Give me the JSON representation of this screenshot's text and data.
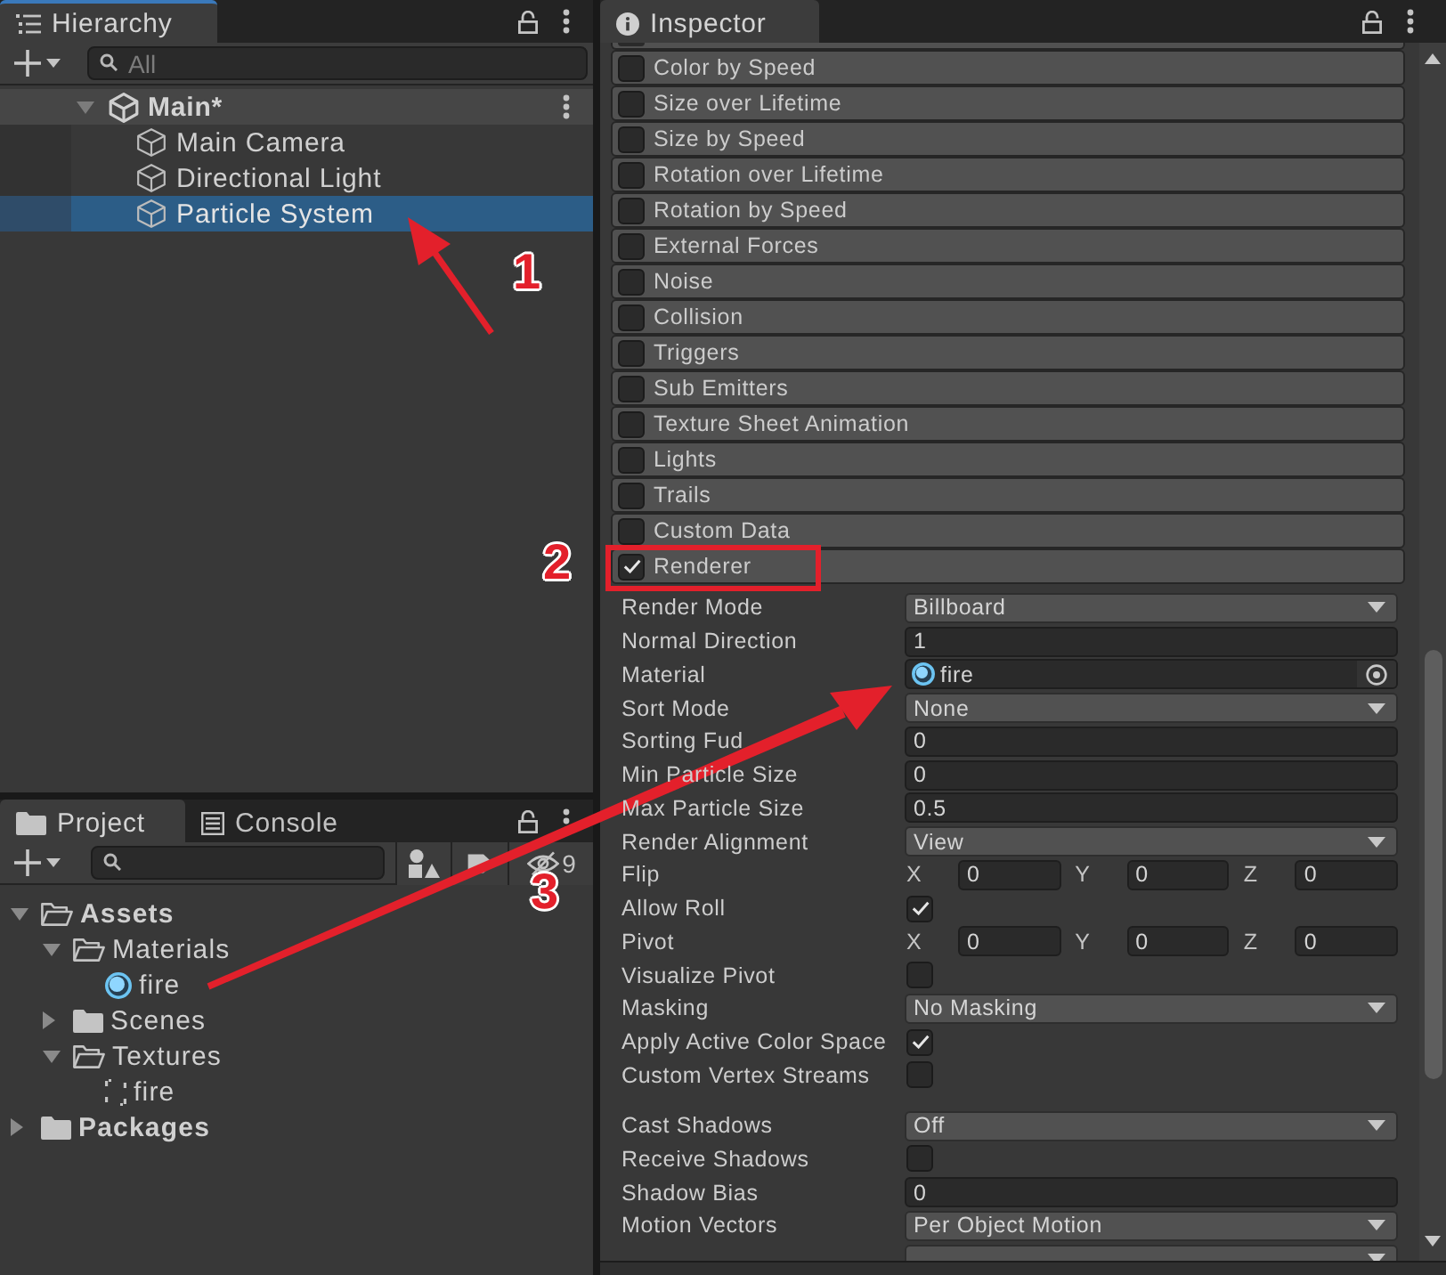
{
  "hierarchy": {
    "tab": {
      "label": "Hierarchy",
      "focused": true
    },
    "search": {
      "placeholder": "All"
    },
    "scene": {
      "name": "Main*",
      "expanded": true
    },
    "items": [
      {
        "name": "Main Camera",
        "selected": false
      },
      {
        "name": "Directional Light",
        "selected": false
      },
      {
        "name": "Particle System",
        "selected": true
      }
    ]
  },
  "project": {
    "tabs": [
      {
        "label": "Project",
        "kind": "project",
        "selected": true,
        "focused": false
      },
      {
        "label": "Console",
        "kind": "console",
        "selected": false,
        "focused": false
      }
    ],
    "hidden_count": "9",
    "tree": [
      {
        "name": "Assets",
        "kind": "folder",
        "expanded": true,
        "children": [
          {
            "name": "Materials",
            "kind": "folder",
            "expanded": true,
            "children": [
              {
                "name": "fire",
                "kind": "material"
              }
            ]
          },
          {
            "name": "Scenes",
            "kind": "folder",
            "expanded": false
          },
          {
            "name": "Textures",
            "kind": "folder",
            "expanded": true,
            "children": [
              {
                "name": "fire",
                "kind": "texture"
              }
            ]
          }
        ]
      },
      {
        "name": "Packages",
        "kind": "folder",
        "expanded": false
      }
    ]
  },
  "inspector": {
    "tab": {
      "label": "Inspector",
      "focused": false
    },
    "modules": [
      {
        "name": "Color by Speed",
        "enabled": false,
        "highlighted": false
      },
      {
        "name": "Size over Lifetime",
        "enabled": false,
        "highlighted": false
      },
      {
        "name": "Size by Speed",
        "enabled": false,
        "highlighted": false
      },
      {
        "name": "Rotation over Lifetime",
        "enabled": false,
        "highlighted": false
      },
      {
        "name": "Rotation by Speed",
        "enabled": false,
        "highlighted": false
      },
      {
        "name": "External Forces",
        "enabled": false,
        "highlighted": false
      },
      {
        "name": "Noise",
        "enabled": false,
        "highlighted": false
      },
      {
        "name": "Collision",
        "enabled": false,
        "highlighted": false
      },
      {
        "name": "Triggers",
        "enabled": false,
        "highlighted": false
      },
      {
        "name": "Sub Emitters",
        "enabled": false,
        "highlighted": false
      },
      {
        "name": "Texture Sheet Animation",
        "enabled": false,
        "highlighted": false
      },
      {
        "name": "Lights",
        "enabled": false,
        "highlighted": false
      },
      {
        "name": "Trails",
        "enabled": false,
        "highlighted": false
      },
      {
        "name": "Custom Data",
        "enabled": false,
        "highlighted": false
      },
      {
        "name": "Renderer",
        "enabled": true,
        "highlighted": true
      }
    ],
    "property_groups": [
      [
        {
          "label": "Render Mode",
          "kind": "dropdown",
          "value": "Billboard"
        },
        {
          "label": "Normal Direction",
          "kind": "number",
          "value": "1"
        },
        {
          "label": "Material",
          "kind": "object",
          "value": "fire"
        },
        {
          "label": "Sort Mode",
          "kind": "dropdown",
          "value": "None"
        },
        {
          "label": "Sorting Fud",
          "kind": "number",
          "value": "0"
        },
        {
          "label": "Min Particle Size",
          "kind": "number",
          "value": "0"
        },
        {
          "label": "Max Particle Size",
          "kind": "number",
          "value": "0.5"
        },
        {
          "label": "Render Alignment",
          "kind": "dropdown",
          "value": "View"
        },
        {
          "label": "Flip",
          "kind": "vector",
          "axes": [
            {
              "axis": "X",
              "value": "0"
            },
            {
              "axis": "Y",
              "value": "0"
            },
            {
              "axis": "Z",
              "value": "0"
            }
          ]
        },
        {
          "label": "Allow Roll",
          "kind": "toggle",
          "checked": true
        },
        {
          "label": "Pivot",
          "kind": "vector",
          "axes": [
            {
              "axis": "X",
              "value": "0"
            },
            {
              "axis": "Y",
              "value": "0"
            },
            {
              "axis": "Z",
              "value": "0"
            }
          ]
        },
        {
          "label": "Visualize Pivot",
          "kind": "toggle",
          "checked": false
        },
        {
          "label": "Masking",
          "kind": "dropdown",
          "value": "No Masking"
        },
        {
          "label": "Apply Active Color Space",
          "kind": "toggle",
          "checked": true
        },
        {
          "label": "Custom Vertex Streams",
          "kind": "toggle",
          "checked": false
        }
      ],
      [
        {
          "label": "Cast Shadows",
          "kind": "dropdown",
          "value": "Off"
        },
        {
          "label": "Receive Shadows",
          "kind": "toggle",
          "checked": false
        },
        {
          "label": "Shadow Bias",
          "kind": "number",
          "value": "0"
        },
        {
          "label": "Motion Vectors",
          "kind": "dropdown",
          "value": "Per Object Motion"
        },
        {
          "kind": "dropdown"
        }
      ]
    ]
  },
  "annotations": [
    {
      "label": "1",
      "kind": "arrow"
    },
    {
      "label": "2",
      "kind": "label"
    },
    {
      "label": "3",
      "kind": "arrow"
    }
  ]
}
